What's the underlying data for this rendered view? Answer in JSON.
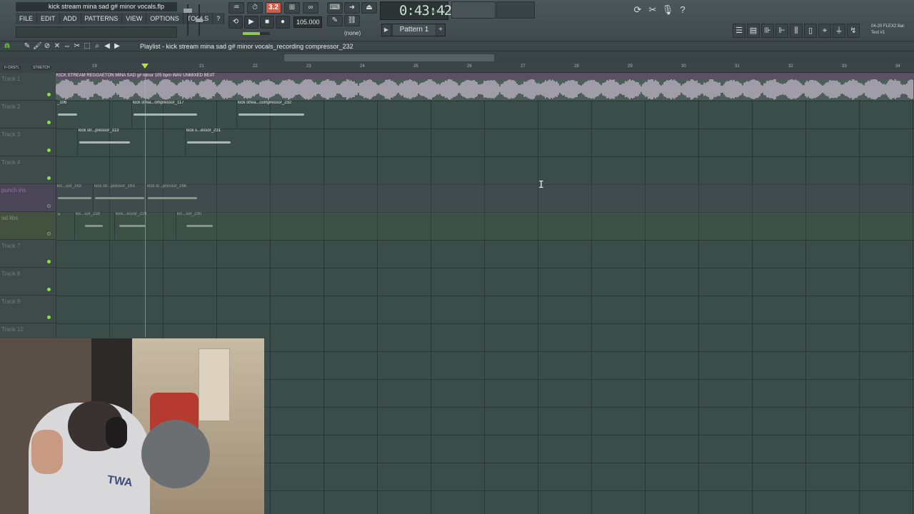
{
  "window": {
    "title": "kick stream mina sad g# minor vocals.flp"
  },
  "menu": [
    "FILE",
    "EDIT",
    "ADD",
    "PATTERNS",
    "VIEW",
    "OPTIONS",
    "TOOLS",
    "?"
  ],
  "transport": {
    "pat_song_label": "3.2",
    "tempo": "105.000",
    "time": "0:43:42",
    "time_unit": "M:S:CS",
    "snap": "(none)",
    "pattern": "Pattern 1"
  },
  "news": {
    "line1": "04-20  FLEX2 Bar",
    "line2": "Test #1"
  },
  "playlist": {
    "title": "Playlist - kick stream mina sad g# minor vocals_recording compressor_232",
    "ruler_left": [
      "F-CRSTL",
      "STRETCH"
    ],
    "ruler_numbers": [
      "19",
      "21",
      "22",
      "23",
      "24",
      "25",
      "26",
      "27",
      "28",
      "29",
      "30",
      "31",
      "32",
      "33",
      "34"
    ]
  },
  "tracks": [
    {
      "name": "Track 1"
    },
    {
      "name": "Track 2"
    },
    {
      "name": "Track 3"
    },
    {
      "name": "Track 4"
    },
    {
      "name": "punch ins"
    },
    {
      "name": "ad libs"
    },
    {
      "name": "Track 7"
    },
    {
      "name": "Track 8"
    },
    {
      "name": "Track 9"
    },
    {
      "name": "Track 10"
    }
  ],
  "clips": {
    "main": "KICK STREAM REGGAETON MINA SAD g# minor 105 bpm WAV UNMIXED BEAT",
    "t2": [
      "_106",
      "kick strea...ompressor_117",
      "kick strea...compressor_232"
    ],
    "t3": [
      "kick str...pressor_113",
      "kick s...essor_231"
    ],
    "t5": [
      "kic...sor_162",
      "kick str...pressor_163",
      "kick st...pressor_166"
    ],
    "t6": [
      "kic...sor_228",
      "kick...essor_229",
      "kic...sor_230"
    ]
  },
  "webcam": {
    "shirt_text": "TWA"
  }
}
